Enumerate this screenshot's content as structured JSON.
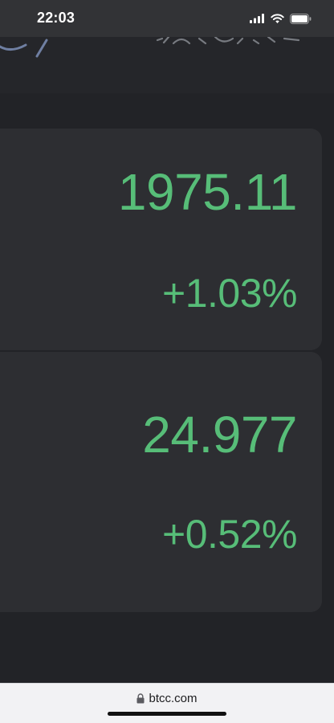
{
  "status_bar": {
    "time": "22:03",
    "icons": [
      "cellular-signal-icon",
      "wifi-icon",
      "battery-icon"
    ]
  },
  "quotes": [
    {
      "price": "1975.11",
      "change": "+1.03%"
    },
    {
      "price": "24.977",
      "change": "+0.52%"
    }
  ],
  "browser": {
    "url": "btcc.com",
    "icon": "lock-icon"
  },
  "colors": {
    "background": "#222327",
    "card": "#2d2e32",
    "positive": "#57bd78",
    "status_bar": "#323336",
    "url_bar": "#f2f2f4"
  }
}
